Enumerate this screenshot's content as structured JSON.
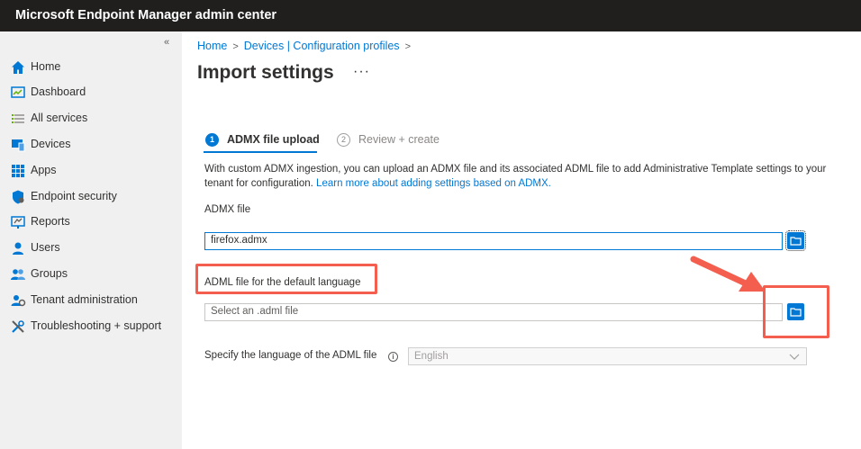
{
  "app": {
    "title": "Microsoft Endpoint Manager admin center"
  },
  "sidebar": {
    "collapse_glyph": "«",
    "items": [
      {
        "label": "Home",
        "icon": "home-icon"
      },
      {
        "label": "Dashboard",
        "icon": "dashboard-icon"
      },
      {
        "label": "All services",
        "icon": "list-icon"
      },
      {
        "label": "Devices",
        "icon": "devices-icon"
      },
      {
        "label": "Apps",
        "icon": "apps-icon"
      },
      {
        "label": "Endpoint security",
        "icon": "shield-icon"
      },
      {
        "label": "Reports",
        "icon": "reports-icon"
      },
      {
        "label": "Users",
        "icon": "user-icon"
      },
      {
        "label": "Groups",
        "icon": "groups-icon"
      },
      {
        "label": "Tenant administration",
        "icon": "tenant-admin-icon"
      },
      {
        "label": "Troubleshooting + support",
        "icon": "tools-icon"
      }
    ]
  },
  "breadcrumb": {
    "home": "Home",
    "devices": "Devices | Configuration profiles",
    "sep": ">"
  },
  "page": {
    "title": "Import settings",
    "more": "···"
  },
  "wizard": {
    "steps": [
      {
        "num": "1",
        "label": "ADMX file upload",
        "active": true
      },
      {
        "num": "2",
        "label": "Review + create",
        "active": false
      }
    ]
  },
  "form": {
    "description": "With custom ADMX ingestion, you can upload an ADMX file and its associated ADML file to add Administrative Template settings to your tenant for configuration.",
    "learn_more": "Learn more about adding settings based on ADMX.",
    "admx_label": "ADMX file",
    "admx_value": "firefox.admx",
    "adml_label": "ADML file for the default language",
    "adml_placeholder": "Select an .adml file",
    "language_label": "Specify the language of the ADML file",
    "info_glyph": "i",
    "language_value": "English"
  },
  "colors": {
    "accent": "#0078d4",
    "annotation": "#f45e4e",
    "topbar": "#201f1e"
  }
}
